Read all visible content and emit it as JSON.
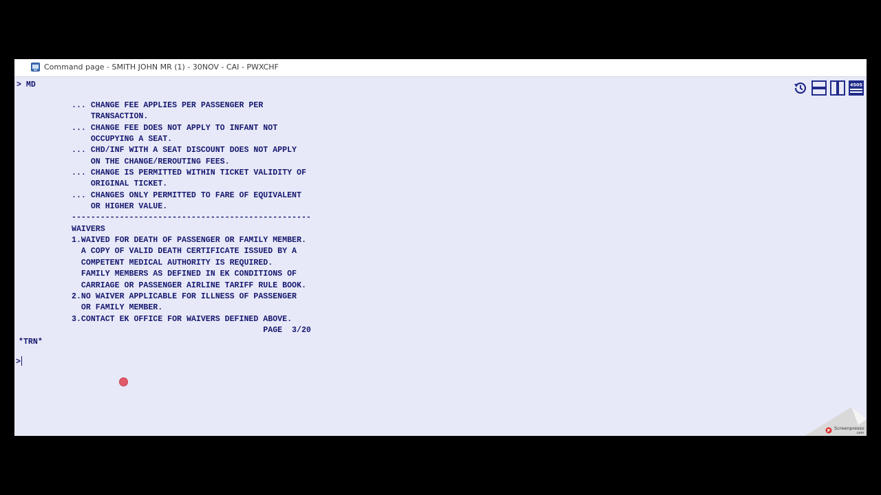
{
  "window": {
    "title": "Command page - SMITH JOHN MR (1) - 30NOV - CAI - PWXCHF",
    "title_icon": "terminal-icon"
  },
  "terminal": {
    "command": "> MD",
    "output_lines": [
      "... CHANGE FEE APPLIES PER PASSENGER PER",
      "    TRANSACTION.",
      "... CHANGE FEE DOES NOT APPLY TO INFANT NOT",
      "    OCCUPYING A SEAT.",
      "... CHD/INF WITH A SEAT DISCOUNT DOES NOT APPLY",
      "    ON THE CHANGE/REROUTING FEES.",
      "... CHANGE IS PERMITTED WITHIN TICKET VALIDITY OF",
      "    ORIGINAL TICKET.",
      "... CHANGES ONLY PERMITTED TO FARE OF EQUIVALENT",
      "    OR HIGHER VALUE.",
      "--------------------------------------------------",
      "WAIVERS",
      "1.WAIVED FOR DEATH OF PASSENGER OR FAMILY MEMBER.",
      "  A COPY OF VALID DEATH CERTIFICATE ISSUED BY A",
      "  COMPETENT MEDICAL AUTHORITY IS REQUIRED.",
      "  FAMILY MEMBERS AS DEFINED IN EK CONDITIONS OF",
      "  CARRIAGE OR PASSENGER AIRLINE TARIFF RULE BOOK.",
      "2.NO WAIVER APPLICABLE FOR ILLNESS OF PASSENGER",
      "  OR FAMILY MEMBER.",
      "3.CONTACT EK OFFICE FOR WAIVERS DEFINED ABOVE.",
      "                                        PAGE  3/20"
    ],
    "trn": "*TRN*",
    "prompt": ">"
  },
  "toolbar": {
    "history_icon": "history-icon",
    "split_horizontal_icon": "split-horizontal-icon",
    "split_vertical_icon": "split-vertical-icon",
    "keyboard_badge": "4505"
  },
  "watermark": {
    "text": "Screenpresso",
    "subtext": ".com"
  },
  "colors": {
    "terminal_bg": "#e8e9f8",
    "terminal_text": "#15186e",
    "toolbar_icon": "#1f2a8a"
  }
}
